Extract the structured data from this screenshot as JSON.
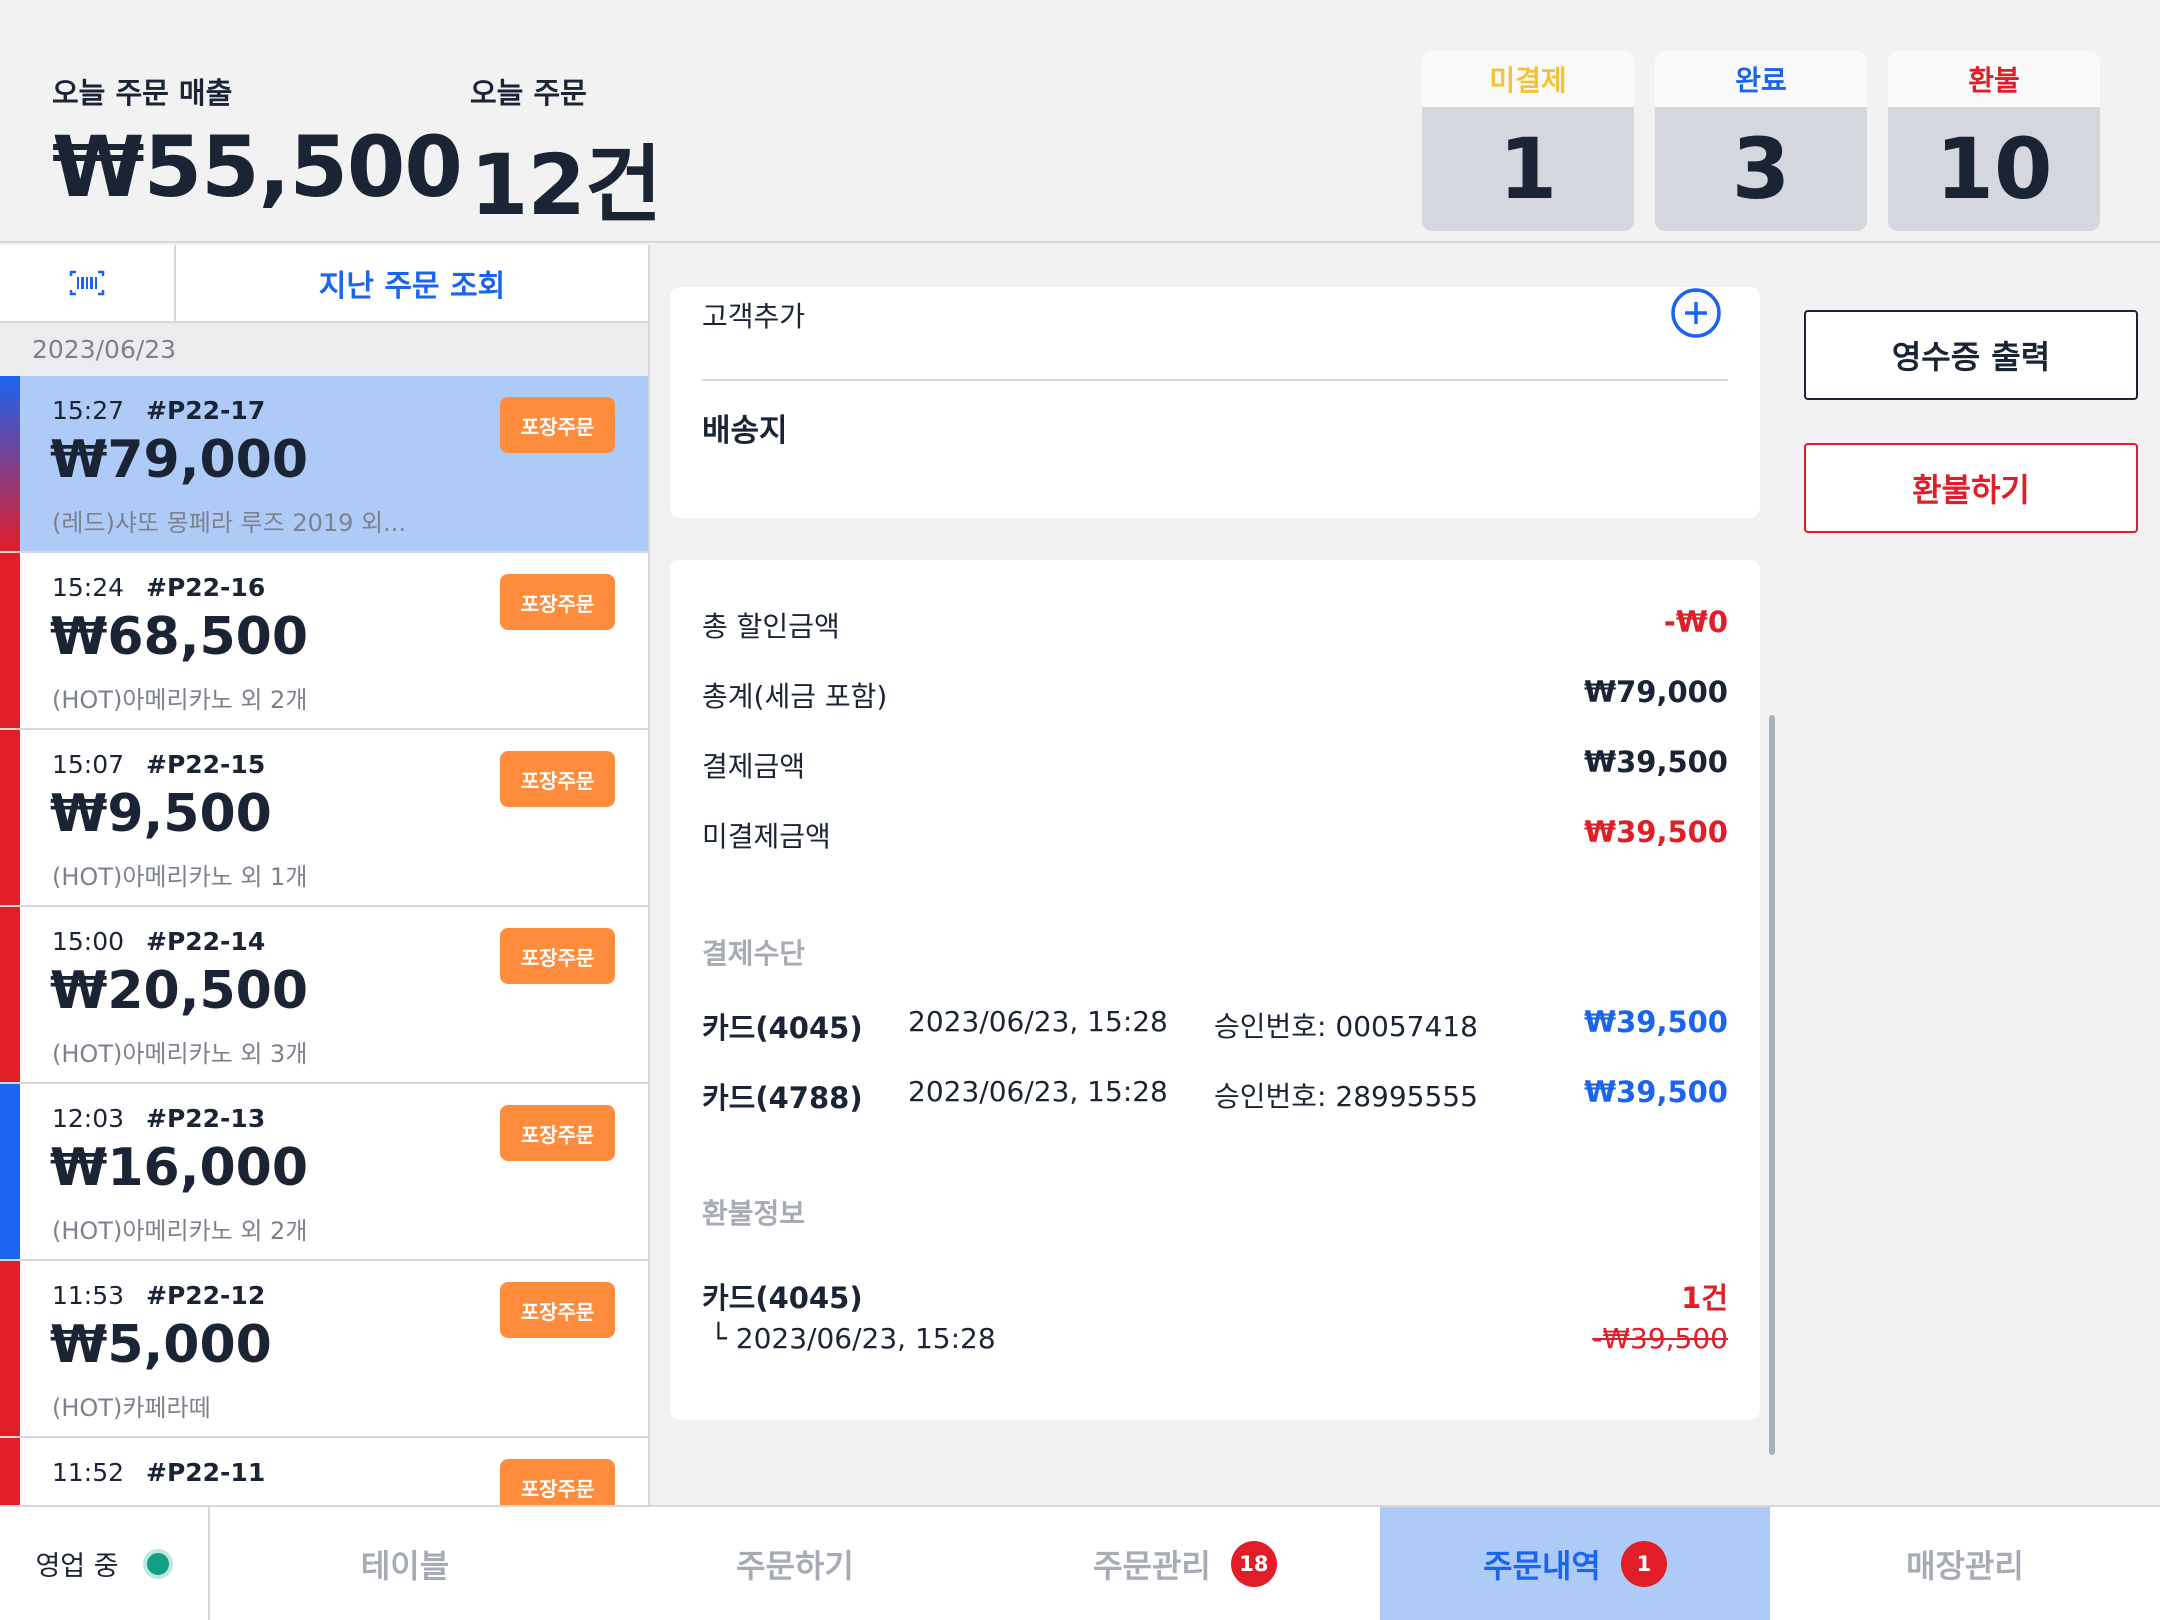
{
  "header": {
    "sales_label": "오늘 주문 매출",
    "sales_value": "₩55,500",
    "count_label": "오늘 주문",
    "count_value": "12건",
    "cards": [
      {
        "label": "미결제",
        "value": "1",
        "color": "#f5c232"
      },
      {
        "label": "완료",
        "value": "3",
        "color": "#1b64f0"
      },
      {
        "label": "환불",
        "value": "10",
        "color": "#e11d27"
      }
    ]
  },
  "left_panel": {
    "barcode_icon": "barcode-icon",
    "past_orders_label": "지난 주문 조회",
    "date": "2023/06/23",
    "orders": [
      {
        "time": "15:27",
        "number": "#P22-17",
        "amount": "₩79,000",
        "items": "(레드)샤또 몽페라 루즈 2019 외...",
        "tag": "포장주문",
        "stripe": "gradient"
      },
      {
        "time": "15:24",
        "number": "#P22-16",
        "amount": "₩68,500",
        "items": "(HOT)아메리카노 외 2개",
        "tag": "포장주문",
        "stripe": "#e11d27"
      },
      {
        "time": "15:07",
        "number": "#P22-15",
        "amount": "₩9,500",
        "items": "(HOT)아메리카노 외 1개",
        "tag": "포장주문",
        "stripe": "#e11d27"
      },
      {
        "time": "15:00",
        "number": "#P22-14",
        "amount": "₩20,500",
        "items": "(HOT)아메리카노 외 3개",
        "tag": "포장주문",
        "stripe": "#e11d27"
      },
      {
        "time": "12:03",
        "number": "#P22-13",
        "amount": "₩16,000",
        "items": "(HOT)아메리카노 외 2개",
        "tag": "포장주문",
        "stripe": "#1b64f0"
      },
      {
        "time": "11:53",
        "number": "#P22-12",
        "amount": "₩5,000",
        "items": "(HOT)카페라떼",
        "tag": "포장주문",
        "stripe": "#e11d27"
      },
      {
        "time": "11:52",
        "number": "#P22-11",
        "amount": "",
        "items": "",
        "tag": "포장주문",
        "stripe": "#e11d27"
      }
    ]
  },
  "customer": {
    "add_label": "고객추가",
    "add_icon": "plus-circle-icon",
    "address_label": "배송지"
  },
  "payment": {
    "discount_label": "총 할인금액",
    "discount_value": "-₩0",
    "total_label": "총계(세금 포함)",
    "total_value": "₩79,000",
    "paid_label": "결제금액",
    "paid_value": "₩39,500",
    "unpaid_label": "미결제금액",
    "unpaid_value": "₩39,500",
    "methods_label": "결제수단",
    "methods": [
      {
        "card": "카드(4045)",
        "datetime": "2023/06/23, 15:28",
        "approval": "승인번호: 00057418",
        "amount": "₩39,500"
      },
      {
        "card": "카드(4788)",
        "datetime": "2023/06/23, 15:28",
        "approval": "승인번호: 28995555",
        "amount": "₩39,500"
      }
    ],
    "refund_label": "환불정보",
    "refund": {
      "card": "카드(4045)",
      "count": "1건",
      "datetime": "└ 2023/06/23, 15:28",
      "amount": "-₩39,500"
    }
  },
  "actions": {
    "receipt_label": "영수증 출력",
    "refund_label": "환불하기"
  },
  "bottom_nav": {
    "status_label": "영업 중",
    "status_color": "#149e83",
    "items": [
      {
        "label": "테이블"
      },
      {
        "label": "주문하기"
      },
      {
        "label": "주문관리",
        "badge": "18"
      },
      {
        "label": "주문내역",
        "badge": "1",
        "active": true
      },
      {
        "label": "매장관리"
      }
    ]
  }
}
